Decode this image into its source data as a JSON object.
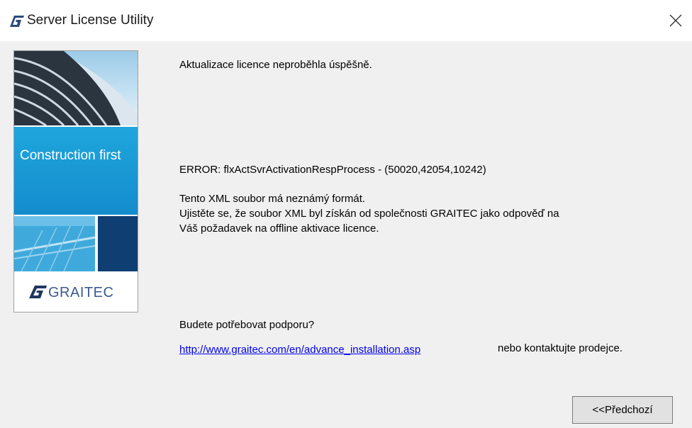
{
  "window": {
    "title": "Server License Utility",
    "close_icon": "close-icon"
  },
  "banner": {
    "tagline": "Construction first",
    "logo_text": "GRAITEC",
    "colors": {
      "sky_blue": "#1ba0db",
      "navy": "#0f3e73",
      "logo_text": "#3a5b8c"
    }
  },
  "message": {
    "status": "Aktualizace licence neproběhla úspěšně.",
    "error": "ERROR: flxActSvrActivationRespProcess - (50020,42054,10242)",
    "detail_line1": "Tento XML soubor má neznámý formát.",
    "detail_line2": "Ujistěte se, že soubor XML byl získán od společnosti GRAITEC jako odpověď na",
    "detail_line3": "Váš požadavek na offline aktivace licence.",
    "support_question": "Budete potřebovat podporu?",
    "support_link": "http://www.graitec.com/en/advance_installation.asp",
    "support_suffix": "nebo kontaktujte prodejce."
  },
  "buttons": {
    "previous": "<<Předchozí"
  }
}
